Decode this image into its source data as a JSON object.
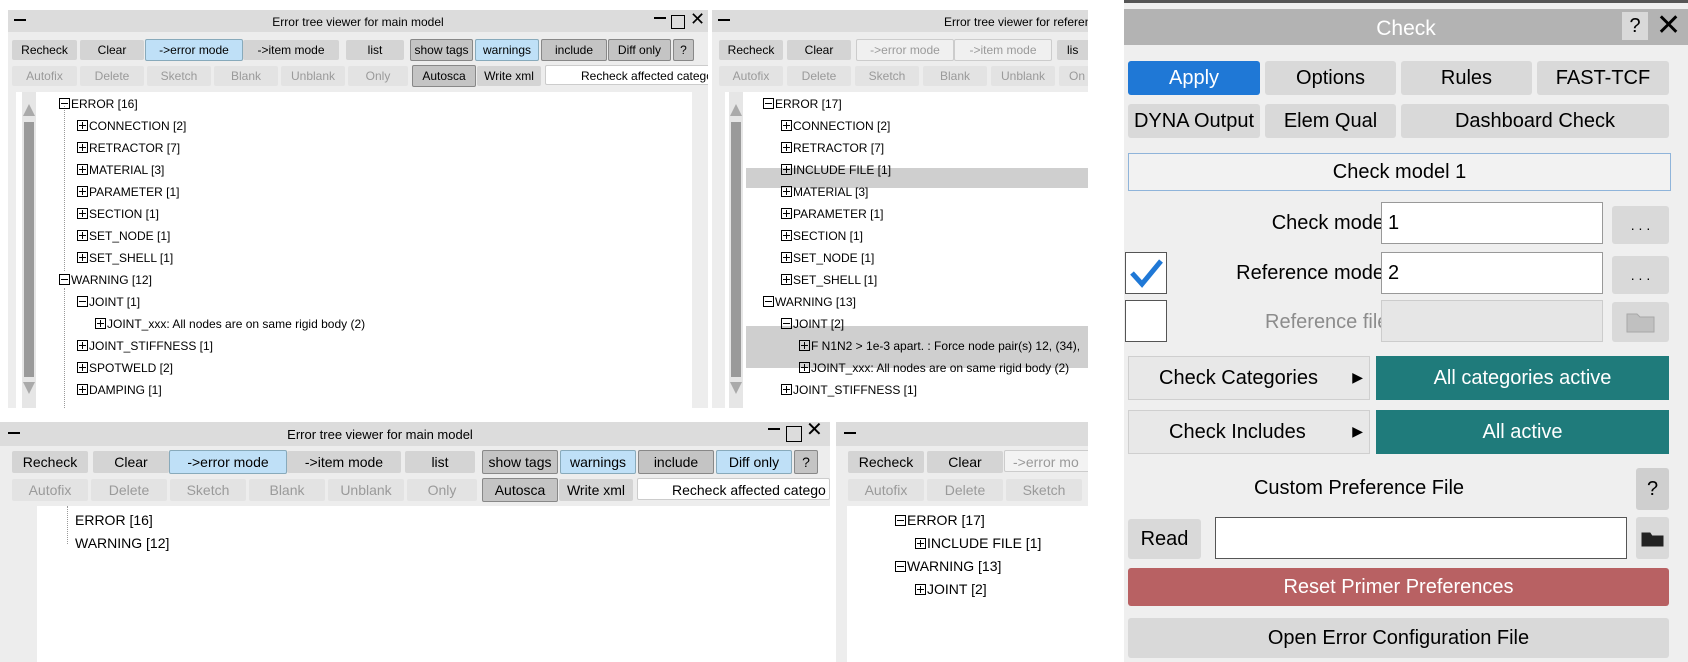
{
  "win1": {
    "title": "Error tree viewer for main model",
    "toolbar1": [
      "Recheck",
      "Clear",
      "->error mode",
      "->item mode",
      "list",
      "show tags",
      "warnings",
      "include",
      "Diff only",
      "?"
    ],
    "toolbar2": [
      "Autofix",
      "Delete",
      "Sketch",
      "Blank",
      "Unblank",
      "Only",
      "Autosca",
      "Write xml",
      "Recheck affected catego"
    ],
    "tree": [
      "ERROR [16]",
      "CONNECTION [2]",
      "RETRACTOR [7]",
      "MATERIAL [3]",
      "PARAMETER [1]",
      "SECTION [1]",
      "SET_NODE [1]",
      "SET_SHELL [1]",
      "WARNING [12]",
      "JOINT [1]",
      "JOINT_xxx: All nodes are on same rigid body (2)",
      "JOINT_STIFFNESS [1]",
      "SPOTWELD [2]",
      "DAMPING [1]"
    ]
  },
  "win2": {
    "title": "Error tree viewer for referen",
    "toolbar1": [
      "Recheck",
      "Clear",
      "->error mode",
      "->item mode",
      "lis"
    ],
    "toolbar2": [
      "Autofix",
      "Delete",
      "Sketch",
      "Blank",
      "Unblank",
      "On"
    ],
    "tree": [
      "ERROR [17]",
      "CONNECTION [2]",
      "RETRACTOR [7]",
      "INCLUDE FILE [1]",
      "MATERIAL [3]",
      "PARAMETER [1]",
      "SECTION [1]",
      "SET_NODE [1]",
      "SET_SHELL [1]",
      "WARNING [13]",
      "JOINT [2]",
      "F N1N2 > 1e-3 apart. : Force node pair(s) 12, (34),",
      "JOINT_xxx: All nodes are on same rigid body (2)",
      "JOINT_STIFFNESS [1]"
    ]
  },
  "win3": {
    "title": "Error tree viewer for main model",
    "toolbar1": [
      "Recheck",
      "Clear",
      "->error mode",
      "->item mode",
      "list",
      "show tags",
      "warnings",
      "include",
      "Diff only",
      "?"
    ],
    "toolbar2": [
      "Autofix",
      "Delete",
      "Sketch",
      "Blank",
      "Unblank",
      "Only",
      "Autosca",
      "Write xml",
      "Recheck affected catego"
    ],
    "tree": [
      "ERROR [16]",
      "WARNING [12]"
    ]
  },
  "win4": {
    "toolbar1": [
      "Recheck",
      "Clear",
      "->error mo"
    ],
    "toolbar2": [
      "Autofix",
      "Delete",
      "Sketch"
    ],
    "tree": [
      "ERROR [17]",
      "INCLUDE FILE [1]",
      "WARNING [13]",
      "JOINT [2]"
    ]
  },
  "check": {
    "title": "Check",
    "help": "?",
    "row1": [
      "Apply",
      "Options",
      "Rules",
      "FAST-TCF"
    ],
    "row2": [
      "DYNA Output",
      "Elem Qual",
      "Dashboard Check"
    ],
    "banner": "Check model 1",
    "check_model_label": "Check model:",
    "check_model_value": "1",
    "ref_model_label": "Reference model:",
    "ref_model_value": "2",
    "ref_file_label": "Reference file:",
    "dots": ". . .",
    "categories_label": "Check Categories",
    "categories_value": "All categories active",
    "includes_label": "Check Includes",
    "includes_value": "All active",
    "custom_pref": "Custom Preference File",
    "read": "Read",
    "reset": "Reset Primer Preferences",
    "open_err": "Open Error Configuration File",
    "colors": {
      "apply": "#1f78d6",
      "teal": "#1f7b7b",
      "reset": "#b86163"
    }
  }
}
